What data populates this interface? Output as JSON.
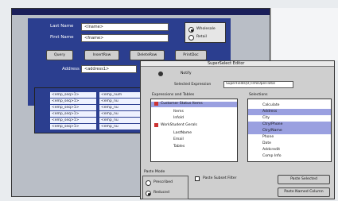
{
  "form": {
    "title": "",
    "last_name_label": "Last Name",
    "last_name_value": "<lname>",
    "first_name_label": "First Name",
    "first_name_value": "<fname>",
    "radio_options": [
      "Wholesale",
      "Retail"
    ],
    "buttons": [
      "Query",
      "InsertRow",
      "DeleteRow",
      "PrintDoc"
    ],
    "address_label": "Address",
    "address_value": "<address1>"
  },
  "grid": {
    "rows": [
      [
        "<emp_seq>1>",
        "<emp_num"
      ],
      [
        "<emp_seq>1>",
        "<emp_nu"
      ],
      [
        "<emp_seq>1>",
        "<emp_nu"
      ],
      [
        "<emp_seq>1>",
        "<emp_nu"
      ],
      [
        "<emp_seq>1>",
        "<emp_nu"
      ],
      [
        "<emp_seq>1>",
        "<emp_nu"
      ]
    ]
  },
  "editor": {
    "title": "SuperSelect Editor",
    "notify_label": "Notify",
    "selected_expression_label": "Selected Expression",
    "selected_expression_value": "SuperFields[0] InfoOpenTotal",
    "tree_header": "Expressions and Tables",
    "tree_items": [
      "Customer Status Items",
      "Items",
      "InfoId",
      "WorkStudent Gerals",
      "LastName",
      "Email",
      "Tables"
    ],
    "sel_header": "Selections",
    "sel_items": [
      "Calculate",
      "Address",
      "City",
      "Ctry/Phone",
      "Ctry/Name",
      "Phone",
      "Date",
      "Addcredit",
      "Comp Info"
    ],
    "sel_highlight": [
      false,
      true,
      false,
      true,
      true,
      false,
      false,
      false,
      false
    ],
    "paste_mode_label": "Paste Mode",
    "paste_options": [
      "Prescribed",
      "Reduced"
    ],
    "paste_selected": 1,
    "checkbox_label": "Paste Subset Filter",
    "action_buttons": [
      "Paste Selected",
      "Paste Named Column"
    ]
  },
  "colors": {
    "window_bg": "#2b3e8f",
    "grid_bg": "#eef2ff",
    "highlight": "#8a8ad6"
  }
}
